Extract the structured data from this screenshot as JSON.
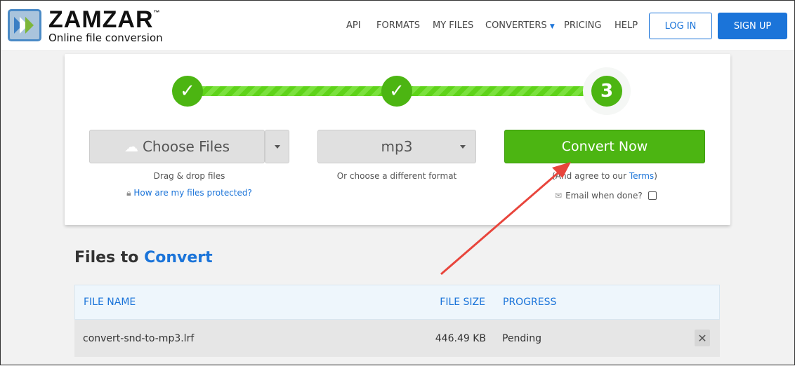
{
  "header": {
    "brand": "ZAMZAR",
    "tm": "™",
    "tagline": "Online file conversion",
    "nav": [
      "API",
      "FORMATS",
      "MY FILES",
      "CONVERTERS",
      "PRICING",
      "HELP"
    ],
    "login": "LOG IN",
    "signup": "SIGN UP"
  },
  "steps": {
    "step1": "✓",
    "step2": "✓",
    "step3": "3"
  },
  "choose": {
    "label": "Choose Files",
    "hint": "Drag & drop files",
    "protect_link": "How are my files protected?"
  },
  "format": {
    "value": "mp3",
    "hint": "Or choose a different format"
  },
  "convert": {
    "label": "Convert Now",
    "agree_prefix": "(And agree to our ",
    "terms": "Terms",
    "agree_suffix": ")",
    "email_label": "Email when done?"
  },
  "files": {
    "title_a": "Files to ",
    "title_b": "Convert",
    "columns": [
      "FILE NAME",
      "FILE SIZE",
      "PROGRESS"
    ],
    "rows": [
      {
        "name": "convert-snd-to-mp3.lrf",
        "size": "446.49 KB",
        "progress": "Pending"
      }
    ]
  },
  "colors": {
    "accent": "#1b74d9",
    "green": "#4cb512",
    "annotation": "#e8453c"
  }
}
